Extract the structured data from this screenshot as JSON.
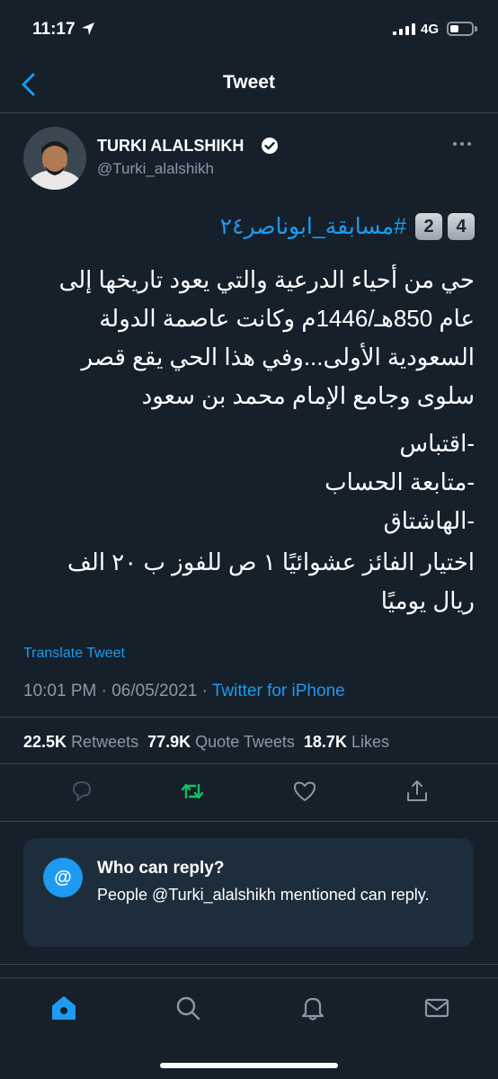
{
  "status_bar": {
    "time": "11:17",
    "network": "4G"
  },
  "header": {
    "title": "Tweet"
  },
  "author": {
    "name": "TURKI ALALSHIKH",
    "handle": "@Turki_alalshikh"
  },
  "tweet": {
    "keycaps": [
      "4",
      "2"
    ],
    "hashtag": "#مسابقة_ابوناصر٢٤",
    "paragraph1": "حي من أحياء الدرعية والتي يعود تاريخها إلى عام 850هـ/1446م وكانت عاصمة الدولة السعودية الأولى...وفي هذا الحي يقع قصر سلوى وجامع الإمام محمد بن سعود",
    "list": [
      "-اقتباس",
      "-متابعة الحساب",
      "-الهاشتاق"
    ],
    "paragraph3": "اختيار الفائز عشوائيًا ١ ص للفوز ب ٢٠ الف ريال يوميًا",
    "translate_label": "Translate Tweet",
    "time": "10:01 PM · 06/05/2021 · ",
    "source": "Twitter for iPhone"
  },
  "stats": {
    "retweets_count": "22.5K",
    "retweets_label": "Retweets",
    "quotes_count": "77.9K",
    "quotes_label": "Quote Tweets",
    "likes_count": "18.7K",
    "likes_label": "Likes"
  },
  "who_can_reply": {
    "title": "Who can reply?",
    "description": "People @Turki_alalshikh mentioned can reply.",
    "icon_text": "@"
  },
  "icons": {
    "back": "chevron-left-icon",
    "verified": "verified-badge-icon",
    "more": "more-dots-icon",
    "reply": "reply-bubble-icon",
    "retweet": "retweet-icon",
    "like": "heart-icon",
    "share": "share-icon",
    "home": "home-icon",
    "search": "search-icon",
    "notifications": "bell-icon",
    "messages": "envelope-icon"
  },
  "colors": {
    "background": "#15202b",
    "accent": "#1d9bf0",
    "retweet_green": "#17bf63",
    "muted": "#8b98a5"
  }
}
